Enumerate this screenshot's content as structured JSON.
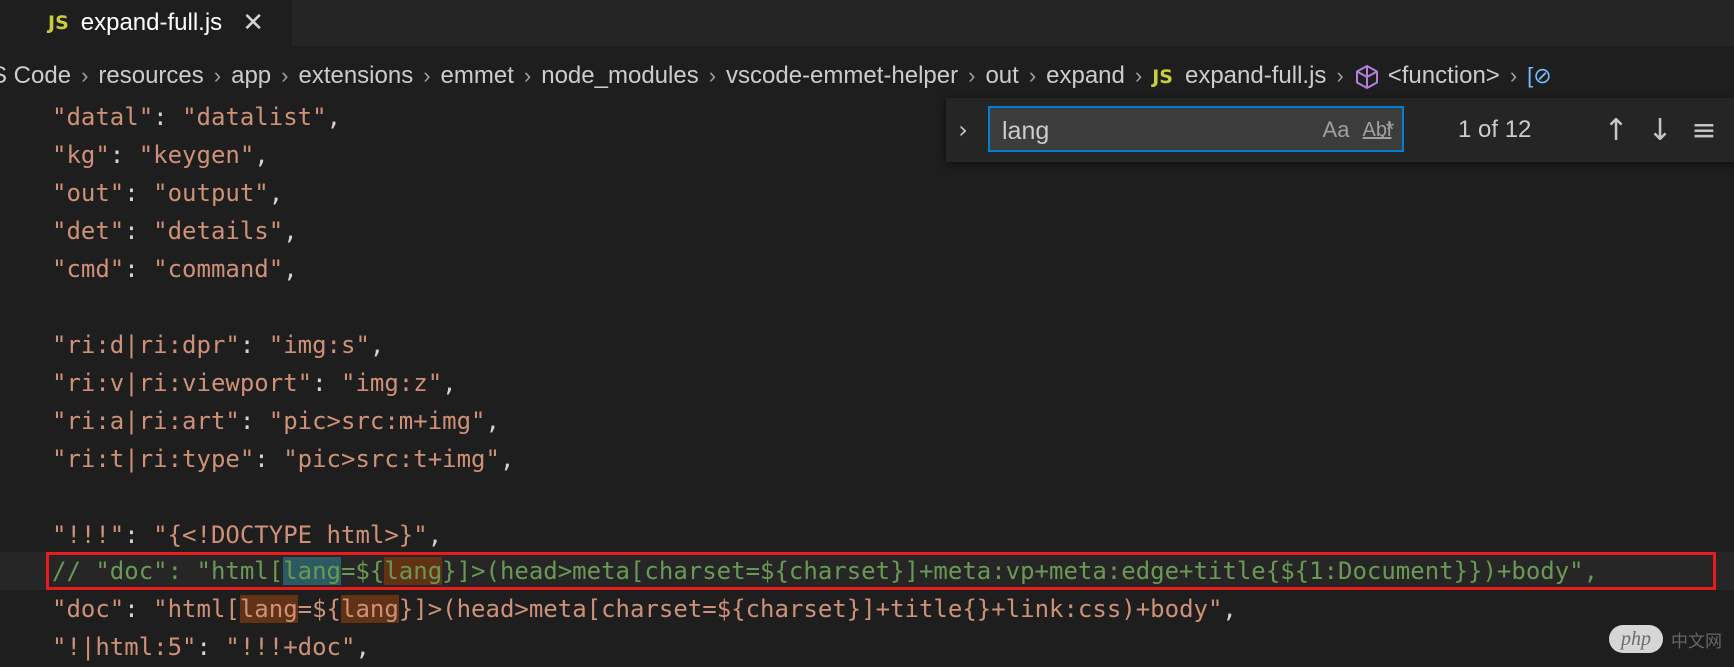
{
  "tab": {
    "icon_text": "JS",
    "label": "expand-full.js",
    "close_glyph": "✕"
  },
  "breadcrumb": {
    "items": [
      "S Code",
      "resources",
      "app",
      "extensions",
      "emmet",
      "node_modules",
      "vscode-emmet-helper",
      "out",
      "expand",
      "expand-full.js",
      "<function>",
      "[⊘"
    ],
    "file_icon_text": "JS"
  },
  "find": {
    "query": "lang",
    "option_case": "Aa",
    "option_word": "Abl",
    "option_regex": ".*",
    "match_count": "1 of 12",
    "prev_glyph": "↑",
    "next_glyph": "↓",
    "selection_glyph": "≡",
    "toggle_glyph": "›"
  },
  "code": {
    "l1k": "\"datal\"",
    "l1v": "\"datalist\"",
    "l2k": "\"kg\"",
    "l2v": "\"keygen\"",
    "l3k": "\"out\"",
    "l3v": "\"output\"",
    "l4k": "\"det\"",
    "l4v": "\"details\"",
    "l5k": "\"cmd\"",
    "l5v": "\"command\"",
    "l7k": "\"ri:d|ri:dpr\"",
    "l7v": "\"img:s\"",
    "l8k": "\"ri:v|ri:viewport\"",
    "l8v": "\"img:z\"",
    "l9k": "\"ri:a|ri:art\"",
    "l9v": "\"pic>src:m+img\"",
    "l10k": "\"ri:t|ri:type\"",
    "l10v": "\"pic>src:t+img\"",
    "l12k": "\"!!!\"",
    "l12v": "\"{<!DOCTYPE html>}\"",
    "l13a": "// \"doc\": \"html[",
    "l13m1": "lang",
    "l13b": "=${",
    "l13m2": "lang",
    "l13c": "}]>(head>meta[charset=${charset}]+meta:vp+meta:edge+title{${1:Document}})+body\",",
    "l14k": "\"doc\"",
    "l14a": "\"html[",
    "l14m1": "lang",
    "l14b": "=${",
    "l14m2": "lang",
    "l14c": "}]>(head>meta[charset=${charset}]+title{}+link:css)+body\"",
    "l15k": "\"!|html:5\"",
    "l15v": "\"!!!+doc\"",
    "colon": ": ",
    "comma": ","
  },
  "watermark": {
    "logo": "php",
    "text": "中文网"
  }
}
